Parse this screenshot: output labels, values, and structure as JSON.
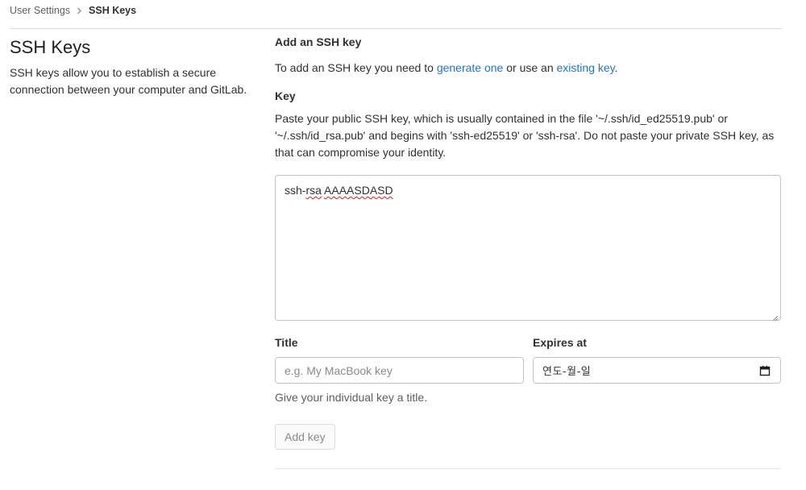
{
  "breadcrumb": {
    "parent": "User Settings",
    "current": "SSH Keys"
  },
  "sidebar": {
    "title": "SSH Keys",
    "description": "SSH keys allow you to establish a secure connection between your computer and GitLab."
  },
  "form": {
    "heading": "Add an SSH key",
    "intro_prefix": "To add an SSH key you need to ",
    "intro_link_generate": "generate one",
    "intro_middle": " or use an ",
    "intro_link_existing": "existing key",
    "intro_suffix": ".",
    "key_label": "Key",
    "key_help": "Paste your public SSH key, which is usually contained in the file '~/.ssh/id_ed25519.pub' or '~/.ssh/id_rsa.pub' and begins with 'ssh-ed25519' or 'ssh-rsa'. Do not paste your private SSH key, as that can compromise your identity.",
    "key_value_prefix": "ssh-",
    "key_value_rsa": "rsa",
    "key_value_space": " ",
    "key_value_rest": "AAAASDASD",
    "title_label": "Title",
    "title_placeholder": "e.g. My MacBook key",
    "title_help": "Give your individual key a title.",
    "expires_label": "Expires at",
    "expires_value": "연도-월-일",
    "expires_icon": "calendar-icon",
    "submit_label": "Add key"
  },
  "colors": {
    "link": "#1f75cb",
    "spellcheck": "#e02020"
  }
}
